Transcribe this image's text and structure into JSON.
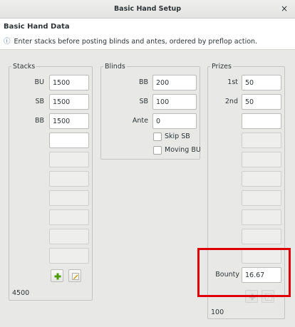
{
  "window": {
    "title": "Basic Hand Setup",
    "close_glyph": "×"
  },
  "header": {
    "title": "Basic Hand Data",
    "info_icon": "ⓘ",
    "description": "Enter stacks before posting blinds and antes, ordered by preflop action."
  },
  "stacks": {
    "legend": "Stacks",
    "rows": [
      {
        "label": "BU",
        "value": "1500"
      },
      {
        "label": "SB",
        "value": "1500"
      },
      {
        "label": "BB",
        "value": "1500"
      },
      {
        "label": "",
        "value": ""
      },
      {
        "label": "",
        "value": ""
      },
      {
        "label": "",
        "value": ""
      },
      {
        "label": "",
        "value": ""
      },
      {
        "label": "",
        "value": ""
      },
      {
        "label": "",
        "value": ""
      },
      {
        "label": "",
        "value": ""
      }
    ],
    "total": "4500"
  },
  "blinds": {
    "legend": "Blinds",
    "bb_label": "BB",
    "bb_value": "200",
    "sb_label": "SB",
    "sb_value": "100",
    "ante_label": "Ante",
    "ante_value": "0",
    "skip_sb_label": "Skip SB",
    "moving_bu_label": "Moving BU"
  },
  "prizes": {
    "legend": "Prizes",
    "rows": [
      {
        "label": "1st",
        "value": "50"
      },
      {
        "label": "2nd",
        "value": "50"
      },
      {
        "label": "",
        "value": ""
      },
      {
        "label": "",
        "value": ""
      },
      {
        "label": "",
        "value": ""
      },
      {
        "label": "",
        "value": ""
      },
      {
        "label": "",
        "value": ""
      },
      {
        "label": "",
        "value": ""
      },
      {
        "label": "",
        "value": ""
      }
    ],
    "bounty_label": "Bounty",
    "bounty_value": "16.67",
    "total": "100"
  }
}
